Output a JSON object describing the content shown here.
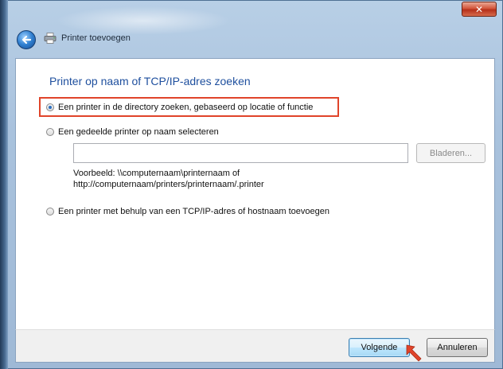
{
  "window": {
    "title": "Printer toevoegen",
    "close_glyph": "✕"
  },
  "icons": {
    "back": "back-arrow-icon",
    "printer": "printer-icon",
    "pointer_arrow": "red-pointer-arrow-icon"
  },
  "colors": {
    "accent_heading": "#1e4f9e",
    "highlight_box": "#e0442a",
    "radio_dot": "#2a6fc2",
    "close_button": "#c8432a"
  },
  "page": {
    "heading": "Printer op naam of TCP/IP-adres zoeken",
    "options": [
      {
        "label": "Een printer in de directory zoeken, gebaseerd op locatie of functie",
        "selected": true
      },
      {
        "label": "Een gedeelde printer op naam selecteren",
        "selected": false
      },
      {
        "label": "Een printer met behulp van een TCP/IP-adres of hostnaam toevoegen",
        "selected": false
      }
    ],
    "shared_printer": {
      "input_value": "",
      "browse_label": "Bladeren...",
      "example_line1": "Voorbeeld: \\\\computernaam\\printernaam of",
      "example_line2": "http://computernaam/printers/printernaam/.printer"
    }
  },
  "footer": {
    "next_label": "Volgende",
    "cancel_label": "Annuleren"
  }
}
